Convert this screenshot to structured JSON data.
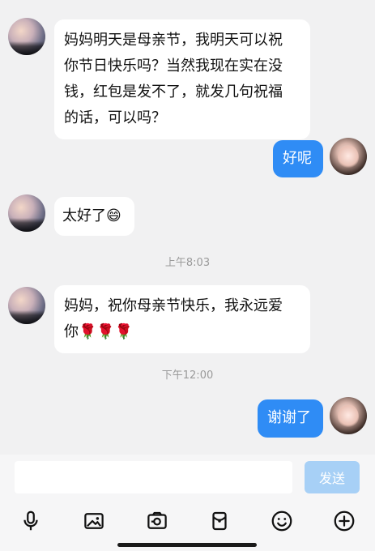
{
  "conversation": {
    "messages": [
      {
        "side": "left",
        "lines": [
          "妈妈明天是母亲节，我明天可以祝",
          "你节日快乐吗？当然我现在实在没",
          "钱，红包是发不了，就发几句祝福",
          "的话，可以吗？"
        ]
      },
      {
        "side": "right",
        "text": "好呢"
      },
      {
        "side": "left",
        "text": "太好了",
        "emoji": "😄"
      },
      {
        "side": "time",
        "text": "上午8:03"
      },
      {
        "side": "left",
        "lines": [
          "妈妈，祝你母亲节快乐，我永远爱",
          "你"
        ],
        "emojis": [
          "🌹",
          "🌹",
          "🌹"
        ]
      },
      {
        "side": "time",
        "text": "下午12:00"
      },
      {
        "side": "right",
        "text": "谢谢了"
      }
    ]
  },
  "composer": {
    "input_value": "",
    "send_label": "发送",
    "icons": [
      "mic-icon",
      "image-icon",
      "camera-icon",
      "red-packet-icon",
      "emoji-icon",
      "plus-icon"
    ]
  },
  "colors": {
    "background": "#f1f1f2",
    "bubble_incoming": "#ffffff",
    "bubble_outgoing": "#2f8cf5",
    "send_disabled": "#a7d0f6",
    "time_text": "#9a9a9a"
  }
}
